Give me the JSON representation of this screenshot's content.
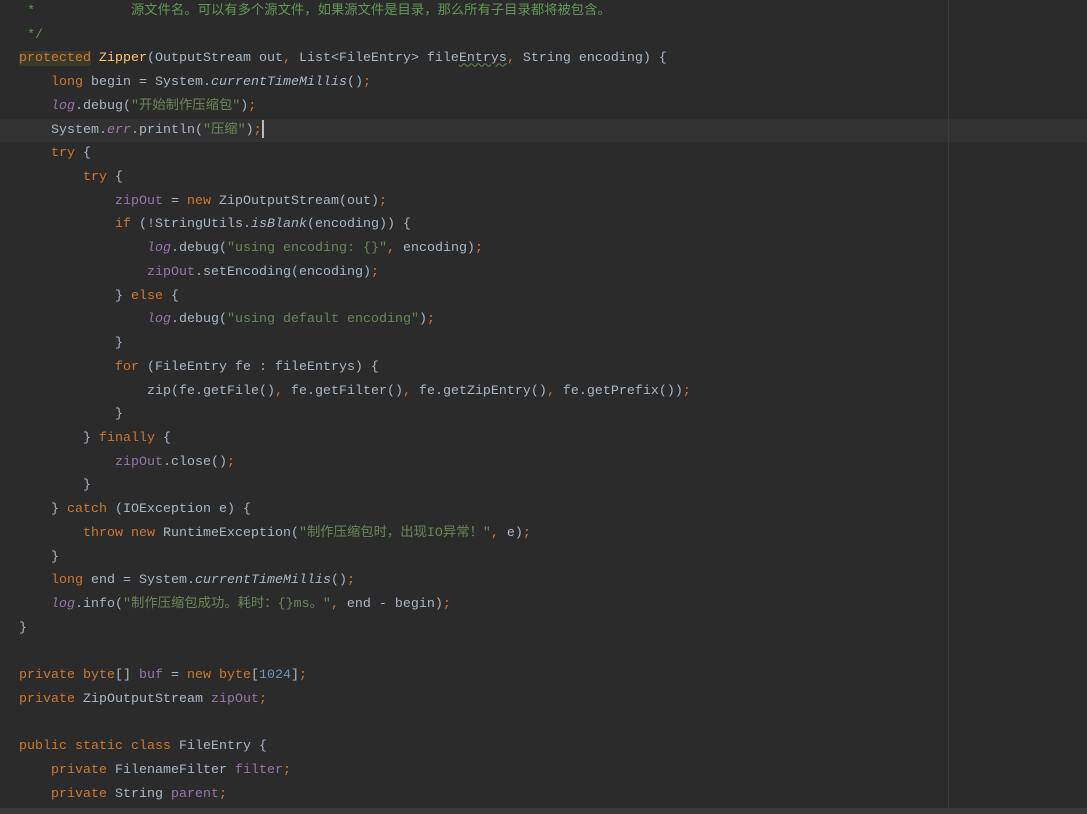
{
  "editor": {
    "colors": {
      "background": "#2b2b2b",
      "keyword": "#cc7832",
      "string": "#6a8759",
      "comment": "#629755",
      "field": "#9876aa",
      "number": "#6897bb",
      "method": "#ffc66d",
      "text": "#a9b7c6"
    },
    "current_line": 5,
    "lines": [
      {
        "indent": 0,
        "tokens": [
          [
            "c",
            " *            源文件名。可以有多个源文件，如果源文件是目录，那么所有子目录都将被包含。"
          ]
        ]
      },
      {
        "indent": 0,
        "tokens": [
          [
            "c",
            " */"
          ]
        ]
      },
      {
        "indent": 0,
        "tokens": [
          [
            "k hl",
            "protected"
          ],
          [
            "t",
            " "
          ],
          [
            "m",
            "Zipper"
          ],
          [
            "t",
            "(OutputStream out"
          ],
          [
            "k",
            ","
          ],
          [
            "t",
            " List<FileEntry> file"
          ],
          [
            "t typo",
            "Entrys"
          ],
          [
            "k",
            ","
          ],
          [
            "t",
            " String encoding) {"
          ]
        ]
      },
      {
        "indent": 1,
        "tokens": [
          [
            "k",
            "long "
          ],
          [
            "t",
            "begin = System."
          ],
          [
            "i",
            "currentTimeMillis"
          ],
          [
            "t",
            "()"
          ],
          [
            "k",
            ";"
          ]
        ]
      },
      {
        "indent": 1,
        "tokens": [
          [
            "fi",
            "log"
          ],
          [
            "t",
            ".debug("
          ],
          [
            "s",
            "\"开始制作压缩包\""
          ],
          [
            "t",
            ")"
          ],
          [
            "k",
            ";"
          ]
        ]
      },
      {
        "indent": 1,
        "tokens": [
          [
            "t",
            "System."
          ],
          [
            "fi",
            "err"
          ],
          [
            "t",
            ".println("
          ],
          [
            "s",
            "\"压缩\""
          ],
          [
            "t",
            ")"
          ],
          [
            "k",
            ";"
          ],
          [
            "caret",
            ""
          ]
        ]
      },
      {
        "indent": 1,
        "tokens": [
          [
            "k",
            "try "
          ],
          [
            "t",
            "{"
          ]
        ]
      },
      {
        "indent": 2,
        "tokens": [
          [
            "k",
            "try "
          ],
          [
            "t",
            "{"
          ]
        ]
      },
      {
        "indent": 3,
        "tokens": [
          [
            "f",
            "zipOut"
          ],
          [
            "t",
            " = "
          ],
          [
            "k",
            "new "
          ],
          [
            "t",
            "ZipOutputStream(out)"
          ],
          [
            "k",
            ";"
          ]
        ]
      },
      {
        "indent": 3,
        "tokens": [
          [
            "k",
            "if "
          ],
          [
            "t",
            "(!StringUtils."
          ],
          [
            "i",
            "isBlank"
          ],
          [
            "t",
            "(encoding)) {"
          ]
        ]
      },
      {
        "indent": 4,
        "tokens": [
          [
            "fi",
            "log"
          ],
          [
            "t",
            ".debug("
          ],
          [
            "s",
            "\"using encoding: {}\""
          ],
          [
            "k",
            ","
          ],
          [
            "t",
            " encoding)"
          ],
          [
            "k",
            ";"
          ]
        ]
      },
      {
        "indent": 4,
        "tokens": [
          [
            "f",
            "zipOut"
          ],
          [
            "t",
            ".setEncoding(encoding)"
          ],
          [
            "k",
            ";"
          ]
        ]
      },
      {
        "indent": 3,
        "tokens": [
          [
            "t",
            "} "
          ],
          [
            "k",
            "else "
          ],
          [
            "t",
            "{"
          ]
        ]
      },
      {
        "indent": 4,
        "tokens": [
          [
            "fi",
            "log"
          ],
          [
            "t",
            ".debug("
          ],
          [
            "s",
            "\"using default encoding\""
          ],
          [
            "t",
            ")"
          ],
          [
            "k",
            ";"
          ]
        ]
      },
      {
        "indent": 3,
        "tokens": [
          [
            "t",
            "}"
          ]
        ]
      },
      {
        "indent": 3,
        "tokens": [
          [
            "k",
            "for "
          ],
          [
            "t",
            "(FileEntry fe : fileEntrys) {"
          ]
        ]
      },
      {
        "indent": 4,
        "tokens": [
          [
            "t",
            "zip(fe.getFile()"
          ],
          [
            "k",
            ","
          ],
          [
            "t",
            " fe.getFilter()"
          ],
          [
            "k",
            ","
          ],
          [
            "t",
            " fe.getZipEntry()"
          ],
          [
            "k",
            ","
          ],
          [
            "t",
            " fe.getPrefix())"
          ],
          [
            "k",
            ";"
          ]
        ]
      },
      {
        "indent": 3,
        "tokens": [
          [
            "t",
            "}"
          ]
        ]
      },
      {
        "indent": 2,
        "tokens": [
          [
            "t",
            "} "
          ],
          [
            "k",
            "finally "
          ],
          [
            "t",
            "{"
          ]
        ]
      },
      {
        "indent": 3,
        "tokens": [
          [
            "f",
            "zipOut"
          ],
          [
            "t",
            ".close()"
          ],
          [
            "k",
            ";"
          ]
        ]
      },
      {
        "indent": 2,
        "tokens": [
          [
            "t",
            "}"
          ]
        ]
      },
      {
        "indent": 1,
        "tokens": [
          [
            "t",
            "} "
          ],
          [
            "k",
            "catch "
          ],
          [
            "t",
            "(IOException e) {"
          ]
        ]
      },
      {
        "indent": 2,
        "tokens": [
          [
            "k",
            "throw new "
          ],
          [
            "t",
            "RuntimeException("
          ],
          [
            "s",
            "\"制作压缩包时，出现IO异常！\""
          ],
          [
            "k",
            ","
          ],
          [
            "t",
            " e)"
          ],
          [
            "k",
            ";"
          ]
        ]
      },
      {
        "indent": 1,
        "tokens": [
          [
            "t",
            "}"
          ]
        ]
      },
      {
        "indent": 1,
        "tokens": [
          [
            "k",
            "long "
          ],
          [
            "t",
            "end = System."
          ],
          [
            "i",
            "currentTimeMillis"
          ],
          [
            "t",
            "()"
          ],
          [
            "k",
            ";"
          ]
        ]
      },
      {
        "indent": 1,
        "tokens": [
          [
            "fi",
            "log"
          ],
          [
            "t",
            ".info("
          ],
          [
            "s",
            "\"制作压缩包成功。耗时：{}ms。\""
          ],
          [
            "k",
            ","
          ],
          [
            "t",
            " end - begin)"
          ],
          [
            "k",
            ";"
          ]
        ]
      },
      {
        "indent": 0,
        "tokens": [
          [
            "t",
            "}"
          ]
        ]
      },
      {
        "indent": 0,
        "tokens": []
      },
      {
        "indent": 0,
        "tokens": [
          [
            "k",
            "private byte"
          ],
          [
            "t",
            "[] "
          ],
          [
            "f",
            "buf"
          ],
          [
            "t",
            " = "
          ],
          [
            "k",
            "new byte"
          ],
          [
            "t",
            "["
          ],
          [
            "n",
            "1024"
          ],
          [
            "t",
            "]"
          ],
          [
            "k",
            ";"
          ]
        ]
      },
      {
        "indent": 0,
        "tokens": [
          [
            "k",
            "private "
          ],
          [
            "t",
            "ZipOutputStream "
          ],
          [
            "f",
            "zipOut"
          ],
          [
            "k",
            ";"
          ]
        ]
      },
      {
        "indent": 0,
        "tokens": []
      },
      {
        "indent": 0,
        "tokens": [
          [
            "k",
            "public static class "
          ],
          [
            "t",
            "FileEntry {"
          ]
        ]
      },
      {
        "indent": 1,
        "tokens": [
          [
            "k",
            "private "
          ],
          [
            "t",
            "FilenameFilter "
          ],
          [
            "f",
            "filter"
          ],
          [
            "k",
            ";"
          ]
        ]
      },
      {
        "indent": 1,
        "tokens": [
          [
            "k",
            "private "
          ],
          [
            "t",
            "String "
          ],
          [
            "f",
            "parent"
          ],
          [
            "k",
            ";"
          ]
        ]
      }
    ]
  }
}
